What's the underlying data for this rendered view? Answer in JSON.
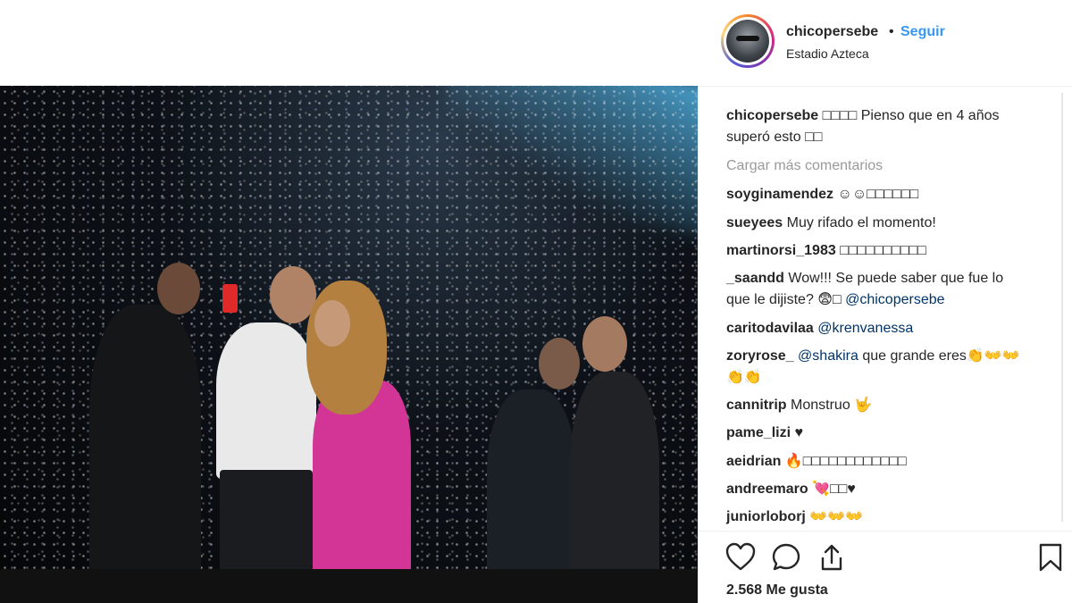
{
  "header": {
    "username": "chicopersebe",
    "separator": "•",
    "follow_label": "Seguir",
    "location": "Estadio Azteca"
  },
  "caption": {
    "username": "chicopersebe",
    "line1": "□□□□ Pienso que en 4 años",
    "line2": "superó esto □□"
  },
  "load_more": "Cargar más comentarios",
  "comments": [
    {
      "user": "soyginamendez",
      "text": "☺☺□□□□□□"
    },
    {
      "user": "sueyees",
      "text": "Muy rifado el momento!"
    },
    {
      "user": "martinorsi_1983",
      "text": "□□□□□□□□□□"
    },
    {
      "user": "_saandd",
      "text": "Wow!!! Se puede saber que fue lo",
      "line2": "que le dijiste? 😨□",
      "mention": "@chicopersebe"
    },
    {
      "user": "caritodavilaa",
      "text": "",
      "mention": "@krenvanessa"
    },
    {
      "user": "zoryrose_",
      "mention": "@shakira",
      "text": "que grande eres👏👐👐",
      "line2": "👏👏"
    },
    {
      "user": "cannitrip",
      "text": "Monstruo 🤟"
    },
    {
      "user": "pame_lizi",
      "text": "♥"
    },
    {
      "user": "aeidrian",
      "text": "🔥□□□□□□□□□□□□"
    },
    {
      "user": "andreemaro",
      "text": "💘□□♥"
    },
    {
      "user": "juniorloborj",
      "text": "👐👐👐"
    }
  ],
  "actions": {
    "like_icon": "heart-icon",
    "comment_icon": "comment-icon",
    "share_icon": "share-icon",
    "save_icon": "bookmark-icon"
  },
  "likes": "2.568 Me gusta",
  "colors": {
    "accent": "#3897f0",
    "text": "#262626",
    "muted": "#999999",
    "mention": "#003569"
  }
}
